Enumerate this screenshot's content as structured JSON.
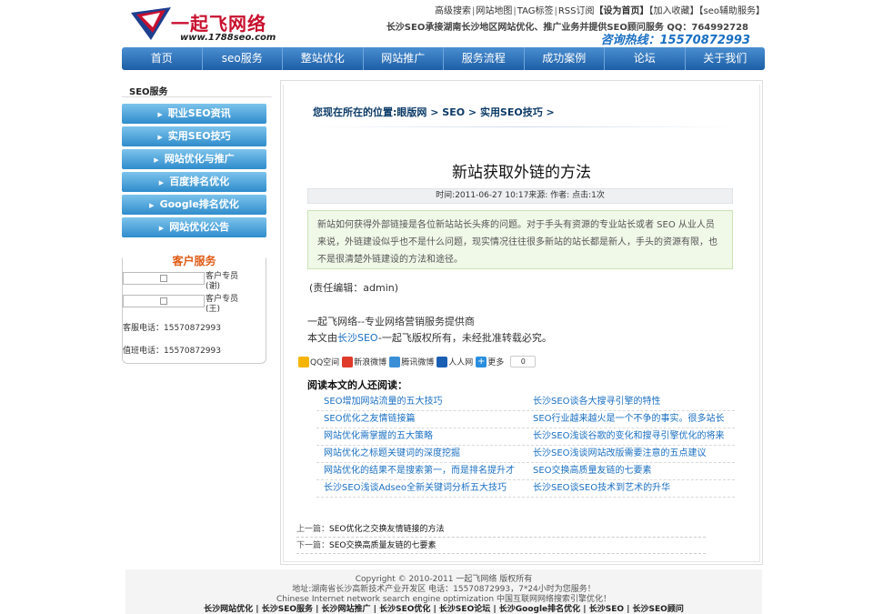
{
  "header": {
    "logo_text": "一起飞网络",
    "logo_url": "www.1788seo.com",
    "toplinks": [
      "高级搜索",
      "网站地图",
      "TAG标签",
      "RSS订阅",
      "【设为首页】",
      "【加入收藏】",
      "【seo辅助服务】"
    ],
    "tagline": "长沙SEO承接湖南长沙地区网站优化、推广业务并提供SEO顾问服务 QQ：764992728",
    "hotline": "咨询热线：15570872993",
    "colors": {
      "brand_red": "#c8102e",
      "nav_blue": "#1d5ea6",
      "link_blue": "#1a6fc2"
    }
  },
  "nav": [
    "首页",
    "seo服务",
    "整站优化",
    "网站推广",
    "服务流程",
    "成功案例",
    "论坛",
    "关于我们"
  ],
  "sidebar": {
    "title": "SEO服务",
    "items": [
      "职业SEO资讯",
      "实用SEO技巧",
      "网站优化与推广",
      "百度排名优化",
      "Google排名优化",
      "网站优化公告"
    ],
    "cs": {
      "title": "客户服务",
      "reps": [
        {
          "label": "客户专员(谢)"
        },
        {
          "label": "客户专员(王)"
        }
      ],
      "phones": [
        "客服电话：15570872993",
        "值班电话：15570872993"
      ]
    }
  },
  "article": {
    "breadcrumb": "您现在所在的位置:眼版网 > SEO > 实用SEO技巧 >",
    "title": "新站获取外链的方法",
    "meta": "时间:2011-06-27 10:17来源: 作者: 点击:1次",
    "summary": "新站如何获得外部链接是各位新站站长头疼的问题。对于手头有资源的专业站长或者 SEO 从业人员来说，外链建设似乎也不是什么问题，现实情况往往很多新站的站长都是新人，手头的资源有限，也不是很清楚外链建设的方法和途径。",
    "editor": "(责任编辑：admin)",
    "promo1": "一起飞网络--专业网络营销服务提供商",
    "promo2_pre": "本文由",
    "promo2_link": "长沙SEO",
    "promo2_post": "-一起飞版权所有，未经批准转载必究。"
  },
  "share": {
    "items": [
      {
        "label": "QQ空间",
        "icon": "qzone-icon",
        "color": "#f5b400"
      },
      {
        "label": "新浪微博",
        "icon": "weibo-icon",
        "color": "#e03a2b"
      },
      {
        "label": "腾讯微博",
        "icon": "tencent-weibo-icon",
        "color": "#3a8fd6"
      },
      {
        "label": "人人网",
        "icon": "renren-icon",
        "color": "#1a5fb4"
      },
      {
        "label": "更多",
        "icon": "plus-icon",
        "color": "#2a8ee0"
      }
    ],
    "count": "0"
  },
  "related": {
    "title": "阅读本文的人还阅读：",
    "rows": [
      [
        "SEO增加网站流量的五大技巧",
        "长沙SEO谈各大搜寻引擎的特性"
      ],
      [
        "SEO优化之友情链接篇",
        "SEO行业越来越火是一个不争的事实。很多站长"
      ],
      [
        "网站优化需掌握的五大策略",
        "长沙SEO浅谈谷歌的变化和搜寻引擎优化的将来"
      ],
      [
        "网站优化之标题关键词的深度挖掘",
        "长沙SEO浅谈网站改版需要注意的五点建议"
      ],
      [
        "网站优化的结果不是搜索第一，而是排名提升才",
        "SEO交换高质量友链的七要素"
      ],
      [
        "长沙SEO浅谈Adseo全新关键词分析五大技巧",
        "长沙SEO谈SEO技术到艺术的升华"
      ]
    ]
  },
  "prevnext": {
    "prev_label": "上一篇：",
    "prev_title": "SEO优化之交换友情链接的方法",
    "next_label": "下一篇：",
    "next_title": "SEO交换高质量友链的七要素"
  },
  "footer": {
    "copyright": "Copyright © 2010-2011 一起飞网络 版权所有",
    "address": "地址:湖南省长沙高新技术产业开发区 电话：15570872993，7*24小时为您服务！",
    "english": "Chinese Internet network search engine optimization 中国互联网网络搜索引擎优化！",
    "links": "长沙网站优化 | 长沙SEO服务 | 长沙网站推广 | 长沙SEO优化 | 长沙SEO论坛 | 长沙Google排名优化 | 长沙SEO | 长沙SEO顾问"
  }
}
